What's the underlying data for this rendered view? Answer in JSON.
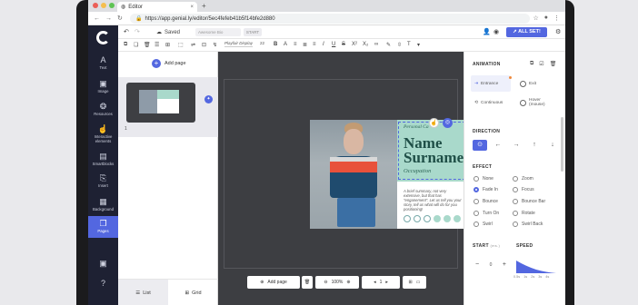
{
  "browser": {
    "tab_title": "Editor",
    "url": "https://app.genial.ly/editor/5ec4fefeb41b5f14bfe2d880"
  },
  "toolbar": {
    "saved_label": "Saved",
    "project_name": "Awesome Bio",
    "start_label": "START",
    "allset_label": "ALL SET!",
    "font": "Playfair Display",
    "font_size": "22"
  },
  "sidebar": {
    "items": [
      {
        "label": "Text",
        "icon": "A"
      },
      {
        "label": "Image",
        "icon": "▣"
      },
      {
        "label": "Resources",
        "icon": "❂"
      },
      {
        "label": "Interactive elements",
        "icon": "☝"
      },
      {
        "label": "Smartblocks",
        "icon": "▤"
      },
      {
        "label": "Insert",
        "icon": "⎘"
      },
      {
        "label": "Background",
        "icon": "▦"
      },
      {
        "label": "Pages",
        "icon": "❐"
      }
    ]
  },
  "pages": {
    "add_label": "Add page",
    "page_number": "1",
    "list_label": "List",
    "grid_label": "Grid"
  },
  "artboard": {
    "pretitle": "Personal Ca",
    "name_line1": "Name",
    "name_line2": "Surname",
    "occupation": "Occupation",
    "summary": "A brief summary, not very extensive, but that has \"enganement\". Let us tell you your story, tell us what will do for you positioning!"
  },
  "bottom": {
    "add_page": "Add page",
    "zoom": "100%",
    "page": "1"
  },
  "rightpanel": {
    "animation_title": "ANIMATION",
    "anim_buttons": [
      "Entrance",
      "Exit",
      "Continuous",
      "Hover (mouse)"
    ],
    "direction_title": "DIRECTION",
    "effect_title": "EFFECT",
    "effects_left": [
      "None",
      "Fade In",
      "Bounce",
      "Turn On",
      "Swirl"
    ],
    "effects_right": [
      "Zoom",
      "Focus",
      "Bounce Bar",
      "Rotate",
      "Swirl Back"
    ],
    "selected_effect": "Fade In",
    "start_title": "START",
    "start_unit": "(ms.)",
    "start_value": "0",
    "speed_title": "SPEED",
    "speed_labels": [
      "0.5s",
      "1s",
      "2s",
      "3s",
      "4s"
    ]
  },
  "colors": {
    "accent": "#5367e0",
    "sidebar_bg": "#1e2133",
    "mint": "#a9d9cb",
    "dark_green": "#1f4f47"
  }
}
